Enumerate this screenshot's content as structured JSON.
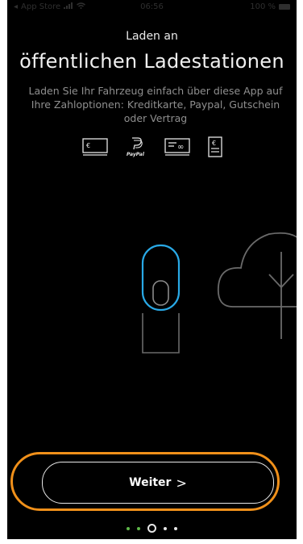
{
  "status_bar": {
    "back_label": "App Store",
    "time": "06:56",
    "battery": "100 %"
  },
  "header": {
    "subtitle": "Laden an",
    "title": "öffentlichen Ladestationen"
  },
  "description": {
    "line1": "Laden Sie Ihr Fahrzeug einfach über diese App auf",
    "line2": "Ihre Zahloptionen: Kreditkarte, Paypal, Gutschein",
    "line3": "oder Vertrag"
  },
  "payment_icons": [
    {
      "name": "credit-card-icon",
      "glyph": "€"
    },
    {
      "name": "paypal-icon",
      "glyph": "PayPal"
    },
    {
      "name": "voucher-icon",
      "glyph": "∞"
    },
    {
      "name": "contract-icon",
      "glyph": "€"
    }
  ],
  "cta": {
    "label": "Weiter",
    "chevron": ">"
  },
  "pagination": {
    "total": 5,
    "current_index": 2
  },
  "colors": {
    "background": "#000000",
    "accent_blue": "#29a9e6",
    "highlight_orange": "#f0901a",
    "dot_green": "#5fb84a"
  }
}
